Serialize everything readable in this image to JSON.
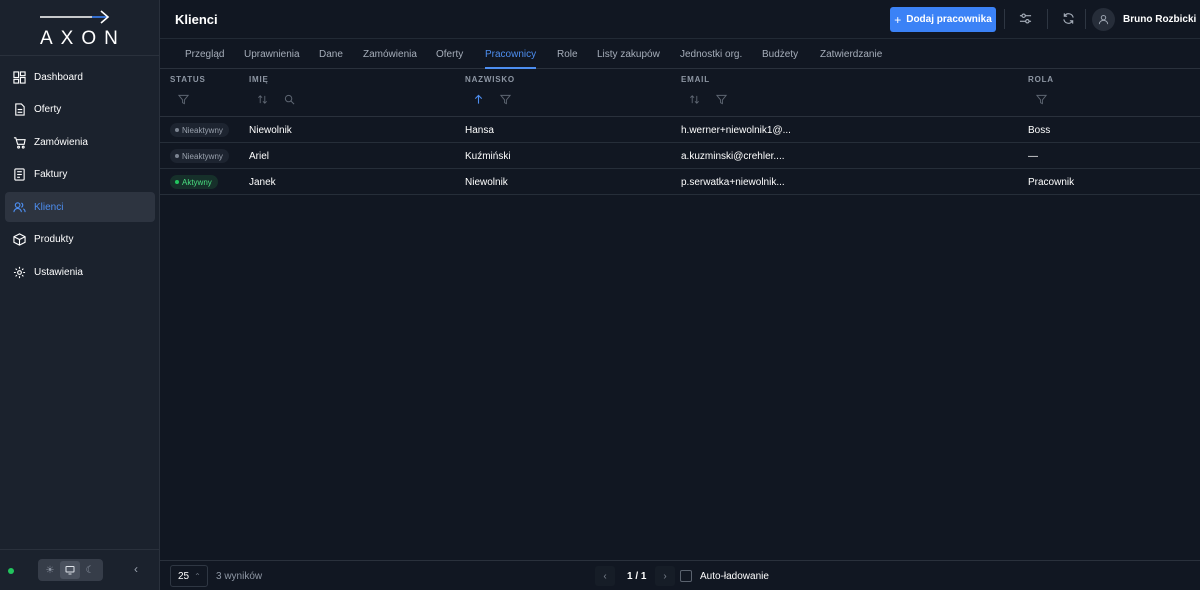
{
  "app": {
    "logo_text": "AXON"
  },
  "sidebar": {
    "items": [
      {
        "label": "Dashboard",
        "icon": "dashboard-icon"
      },
      {
        "label": "Oferty",
        "icon": "document-icon"
      },
      {
        "label": "Zamówienia",
        "icon": "cart-icon"
      },
      {
        "label": "Faktury",
        "icon": "invoice-icon"
      },
      {
        "label": "Klienci",
        "icon": "users-icon",
        "active": true
      },
      {
        "label": "Produkty",
        "icon": "box-icon"
      },
      {
        "label": "Ustawienia",
        "icon": "gear-icon"
      }
    ],
    "theme_options": [
      "light",
      "system",
      "dark"
    ],
    "theme_selected": "system"
  },
  "header": {
    "title": "Klienci",
    "add_button_label": "Dodaj pracownika",
    "user_name": "Bruno Rozbicki"
  },
  "tabs": [
    {
      "label": "Przegląd"
    },
    {
      "label": "Uprawnienia"
    },
    {
      "label": "Dane"
    },
    {
      "label": "Zamówienia"
    },
    {
      "label": "Oferty"
    },
    {
      "label": "Pracownicy",
      "active": true
    },
    {
      "label": "Role"
    },
    {
      "label": "Listy zakupów"
    },
    {
      "label": "Jednostki org."
    },
    {
      "label": "Budżety"
    },
    {
      "label": "Zatwierdzanie"
    }
  ],
  "table": {
    "columns": [
      "STATUS",
      "IMIĘ",
      "NAZWISKO",
      "EMAIL",
      "ROLA"
    ],
    "rows": [
      {
        "status": "Nieaktywny",
        "first_name": "Niewolnik",
        "last_name": "Hansa",
        "email": "h.werner+niewolnik1@...",
        "role": "Boss"
      },
      {
        "status": "Nieaktywny",
        "first_name": "Ariel",
        "last_name": "Kuźmiński",
        "email": "a.kuzminski@crehler....",
        "role": "—"
      },
      {
        "status": "Aktywny",
        "first_name": "Janek",
        "last_name": "Niewolnik",
        "email": "p.serwatka+niewolnik...",
        "role": "Pracownik"
      }
    ]
  },
  "footer": {
    "per_page": "25",
    "results": "3 wyników",
    "page_info": "1 / 1",
    "auto_load_label": "Auto-ładowanie"
  },
  "colors": {
    "accent": "#3b82f6",
    "active_text": "#4d8ef0",
    "status_active": "#22c55e"
  }
}
